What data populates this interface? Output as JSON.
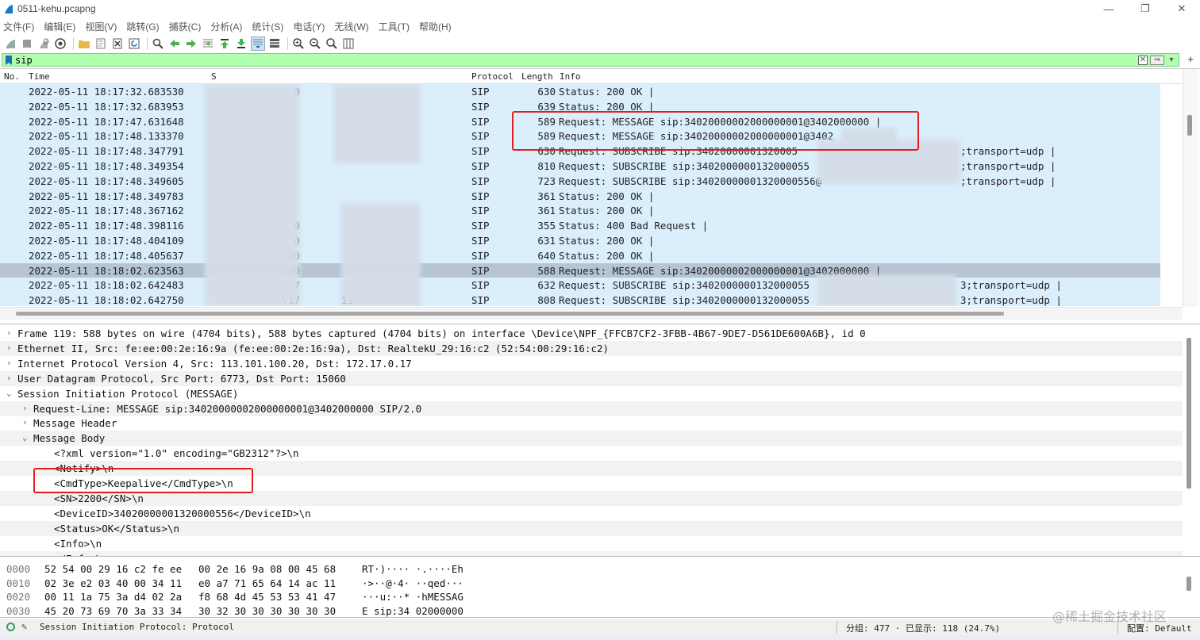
{
  "window": {
    "title": "0511-kehu.pcapng",
    "minimize": "—",
    "restore": "❐",
    "close": "✕"
  },
  "menu": [
    "文件(F)",
    "编辑(E)",
    "视图(V)",
    "跳转(G)",
    "捕获(C)",
    "分析(A)",
    "统计(S)",
    "电话(Y)",
    "无线(W)",
    "工具(T)",
    "帮助(H)"
  ],
  "filter": {
    "value": "sip",
    "accent": "#afffaf"
  },
  "columns": {
    "no": "No.",
    "time": "Time",
    "source": "S",
    "protocol": "Protocol",
    "length": "Length",
    "info": "Info"
  },
  "packets": [
    {
      "time": "2022-05-11 18:17:32.683530",
      "src_frag": "0",
      "dst_frag": "",
      "protocol": "SIP",
      "length": "630",
      "info": "Status: 200 OK |"
    },
    {
      "time": "2022-05-11 18:17:32.683953",
      "src_frag": "",
      "dst_frag": "",
      "protocol": "SIP",
      "length": "639",
      "info": "Status: 200 OK |"
    },
    {
      "time": "2022-05-11 18:17:47.631648",
      "src_frag": "",
      "dst_frag": "",
      "protocol": "SIP",
      "length": "589",
      "info": "Request: MESSAGE sip:34020000002000000001@3402000000 |"
    },
    {
      "time": "2022-05-11 18:17:48.133370",
      "src_frag": "",
      "dst_frag": "",
      "protocol": "SIP",
      "length": "589",
      "info": "Request: MESSAGE sip:34020000002000000001@3402"
    },
    {
      "time": "2022-05-11 18:17:48.347791",
      "src_frag": "",
      "dst_frag": "",
      "protocol": "SIP",
      "length": "630",
      "info": "Request: SUBSCRIBE sip:34020000001320005",
      "info_tail": ";transport=udp |"
    },
    {
      "time": "2022-05-11 18:17:48.349354",
      "src_frag": "",
      "dst_frag": "",
      "protocol": "SIP",
      "length": "810",
      "info": "Request: SUBSCRIBE sip:3402000000132000055",
      "info_tail": ";transport=udp |"
    },
    {
      "time": "2022-05-11 18:17:48.349605",
      "src_frag": "",
      "dst_frag": "",
      "protocol": "SIP",
      "length": "723",
      "info": "Request: SUBSCRIBE sip:34020000001320000556@",
      "info_tail": ";transport=udp |"
    },
    {
      "time": "2022-05-11 18:17:48.349783",
      "src_frag": "",
      "dst_frag": "",
      "protocol": "SIP",
      "length": "361",
      "info": "Status: 200 OK |"
    },
    {
      "time": "2022-05-11 18:17:48.367162",
      "src_frag": "",
      "dst_frag": "",
      "protocol": "SIP",
      "length": "361",
      "info": "Status: 200 OK |"
    },
    {
      "time": "2022-05-11 18:17:48.398116",
      "src_frag": "0",
      "dst_frag": "",
      "protocol": "SIP",
      "length": "355",
      "info": "Status: 400 Bad Request |"
    },
    {
      "time": "2022-05-11 18:17:48.404109",
      "src_frag": "0",
      "dst_frag": "",
      "protocol": "SIP",
      "length": "631",
      "info": "Status: 200 OK |"
    },
    {
      "time": "2022-05-11 18:17:48.405637",
      "src_frag": "20",
      "dst_frag": "",
      "protocol": "SIP",
      "length": "640",
      "info": "Status: 200 OK |"
    },
    {
      "time": "2022-05-11 18:18:02.623563",
      "src_frag": ".20",
      "dst_frag": "",
      "protocol": "SIP",
      "length": "588",
      "info": "Request: MESSAGE sip:34020000002000000001@3402000000 |",
      "selected": true
    },
    {
      "time": "2022-05-11 18:18:02.642483",
      "src_frag": "7",
      "dst_frag": "",
      "protocol": "SIP",
      "length": "632",
      "info": "Request: SUBSCRIBE sip:3402000000132000055",
      "info_tail": "3;transport=udp |"
    },
    {
      "time": "2022-05-11 18:18:02.642750",
      "src_frag": ".17",
      "dst_frag": "11",
      "protocol": "SIP",
      "length": "808",
      "info": "Request: SUBSCRIBE sip:3402000000132000055",
      "info_tail": "3;transport=udp |"
    }
  ],
  "details": [
    {
      "indent": 0,
      "arrow": "›",
      "text": "Frame 119: 588 bytes on wire (4704 bits), 588 bytes captured (4704 bits) on interface \\Device\\NPF_{FFCB7CF2-3FBB-4B67-9DE7-D561DE600A6B}, id 0"
    },
    {
      "indent": 0,
      "arrow": "›",
      "text": "Ethernet II, Src: fe:ee:00:2e:16:9a (fe:ee:00:2e:16:9a), Dst: RealtekU_29:16:c2 (52:54:00:29:16:c2)"
    },
    {
      "indent": 0,
      "arrow": "›",
      "text": "Internet Protocol Version 4, Src: 113.101.100.20, Dst: 172.17.0.17"
    },
    {
      "indent": 0,
      "arrow": "›",
      "text": "User Datagram Protocol, Src Port: 6773, Dst Port: 15060"
    },
    {
      "indent": 0,
      "arrow": "⌄",
      "text": "Session Initiation Protocol (MESSAGE)"
    },
    {
      "indent": 1,
      "arrow": "›",
      "text": "Request-Line: MESSAGE sip:34020000002000000001@3402000000 SIP/2.0"
    },
    {
      "indent": 1,
      "arrow": "›",
      "text": "Message Header"
    },
    {
      "indent": 1,
      "arrow": "⌄",
      "text": "Message Body"
    },
    {
      "indent": 2,
      "arrow": "",
      "text": "<?xml version=\"1.0\" encoding=\"GB2312\"?>\\n"
    },
    {
      "indent": 2,
      "arrow": "",
      "text": "<Notify>\\n"
    },
    {
      "indent": 2,
      "arrow": "",
      "text": "<CmdType>Keepalive</CmdType>\\n"
    },
    {
      "indent": 2,
      "arrow": "",
      "text": "<SN>2200</SN>\\n"
    },
    {
      "indent": 2,
      "arrow": "",
      "text": "<DeviceID>34020000001320000556</DeviceID>\\n"
    },
    {
      "indent": 2,
      "arrow": "",
      "text": "<Status>OK</Status>\\n"
    },
    {
      "indent": 2,
      "arrow": "",
      "text": "<Info>\\n"
    },
    {
      "indent": 2,
      "arrow": "",
      "text": "</Info>\\n"
    }
  ],
  "bytes": [
    {
      "offset": "0000",
      "hex1": "52 54 00 29 16 c2 fe ee",
      "hex2": "00 2e 16 9a 08 00 45 68",
      "ascii": "RT·)···· ·.····Eh"
    },
    {
      "offset": "0010",
      "hex1": "02 3e e2 03 40 00 34 11",
      "hex2": "e0 a7 71 65 64 14 ac 11",
      "ascii": "·>··@·4· ··qed···"
    },
    {
      "offset": "0020",
      "hex1": "00 11 1a 75 3a d4 02 2a",
      "hex2": "f8 68 4d 45 53 53 41 47",
      "ascii": "···u:··* ·hMESSAG"
    },
    {
      "offset": "0030",
      "hex1": "45 20 73 69 70 3a 33 34",
      "hex2": "30 32 30 30 30 30 30 30",
      "ascii": "E sip:34 02000000"
    }
  ],
  "status": {
    "protocol": "Session Initiation Protocol: Protocol",
    "packets": "分组: 477 · 已显示: 118 (24.7%)",
    "profile": "配置: Default"
  },
  "watermark": "@稀土掘金技术社区"
}
